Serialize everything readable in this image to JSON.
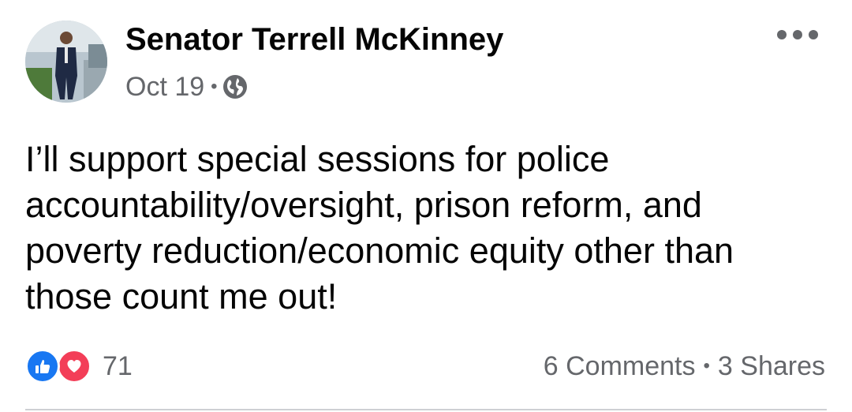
{
  "post": {
    "author": "Senator Terrell McKinney",
    "date": "Oct 19",
    "separator": "•",
    "audience_icon": "globe-icon",
    "more_icon": "more-options-icon",
    "text": "I’ll support special sessions for police accountability/oversight, prison reform, and poverty reduction/economic equity other than those count me out!",
    "reactions": {
      "icons": [
        "like-icon",
        "love-icon"
      ],
      "count": "71"
    },
    "comments": "6 Comments",
    "stats_separator": "•",
    "shares": "3 Shares"
  },
  "colors": {
    "text": "#050505",
    "secondary": "#65676b",
    "like": "#1877f2",
    "love": "#f33e58",
    "divider": "#ced0d4"
  }
}
